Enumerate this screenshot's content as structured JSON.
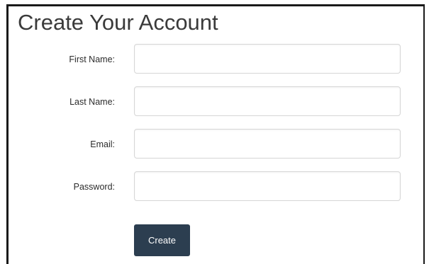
{
  "form": {
    "title": "Create Your Account",
    "fields": [
      {
        "label": "First Name:",
        "value": "",
        "placeholder": ""
      },
      {
        "label": "Last Name:",
        "value": "",
        "placeholder": ""
      },
      {
        "label": "Email:",
        "value": "",
        "placeholder": ""
      },
      {
        "label": "Password:",
        "value": "",
        "placeholder": ""
      }
    ],
    "submit_label": "Create",
    "colors": {
      "button_bg": "#2c3e50",
      "button_text": "#ffffff",
      "title_text": "#3a3a3a"
    }
  }
}
